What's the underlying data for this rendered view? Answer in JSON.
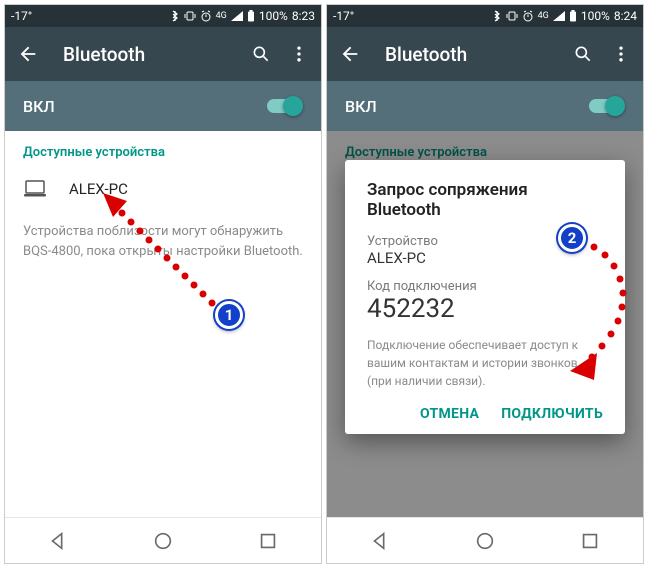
{
  "screen1": {
    "status": {
      "temp": "-17°",
      "battery": "100%",
      "time": "8:23",
      "net": "4G"
    },
    "title": "Bluetooth",
    "toggle_label": "ВКЛ",
    "section_header": "Доступные устройства",
    "device": {
      "name": "ALEX-PC",
      "icon": "laptop-icon"
    },
    "note": "Устройства поблизости могут обнаружить BQS-4800, пока открыты настройки Bluetooth."
  },
  "screen2": {
    "status": {
      "temp": "-17°",
      "battery": "100%",
      "time": "8:24",
      "net": "4G"
    },
    "title": "Bluetooth",
    "toggle_label": "ВКЛ",
    "section_header": "Доступные устройства",
    "dialog": {
      "title": "Запрос сопряжения Bluetooth",
      "device_label": "Устройство",
      "device_name": "ALEX-PC",
      "code_label": "Код подключения",
      "code": "452232",
      "note": "Подключение обеспечивает доступ к вашим контактам и истории звонков (при наличии связи).",
      "cancel": "ОТМЕНА",
      "confirm": "ПОДКЛЮЧИТЬ"
    }
  },
  "annotations": {
    "badge1": "1",
    "badge2": "2"
  }
}
